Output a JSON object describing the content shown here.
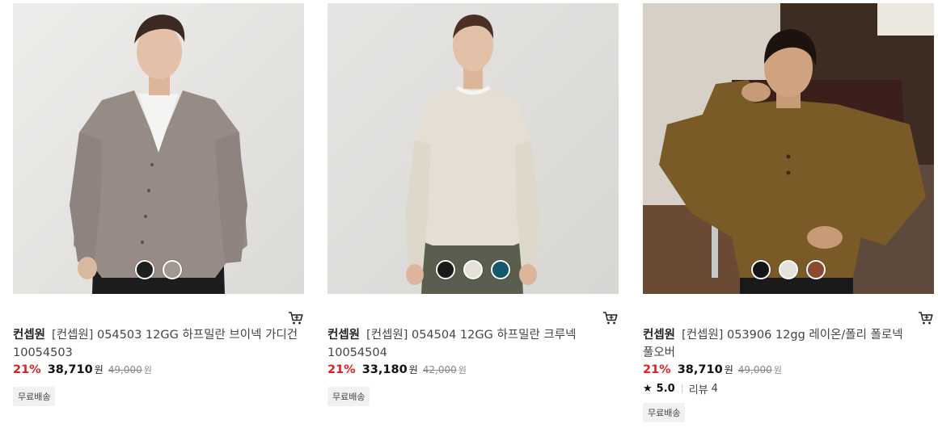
{
  "products": [
    {
      "brand": "컨셉원",
      "name": "[컨셉원] 054503 12GG 하프밀란 브이넥 가디건 10054503",
      "discount": "21%",
      "sale_price": "38,710",
      "currency": "원",
      "original_price": "49,000",
      "badge": "무료배송",
      "swatch_colors": [
        "#1f1f1f",
        "#a39890"
      ]
    },
    {
      "brand": "컨셉원",
      "name": "[컨셉원] 054504 12GG 하프밀란 크루넥 10054504",
      "discount": "21%",
      "sale_price": "33,180",
      "currency": "원",
      "original_price": "42,000",
      "badge": "무료배송",
      "swatch_colors": [
        "#1a1a1a",
        "#e6e1d6",
        "#14586e"
      ]
    },
    {
      "brand": "컨셉원",
      "name": "[컨셉원] 053906 12gg 레이온/폴리 폴로넥 풀오버",
      "discount": "21%",
      "sale_price": "38,710",
      "currency": "원",
      "original_price": "49,000",
      "rating": "5.0",
      "review_label": "리뷰",
      "review_count": "4",
      "badge": "무료배송",
      "swatch_colors": [
        "#151515",
        "#e6e1da",
        "#8a4a30"
      ]
    }
  ],
  "icons": {
    "cart": "cart-icon",
    "star": "star-icon"
  },
  "colors": {
    "discount": "#e02020",
    "badge_bg": "#f1f1f1"
  }
}
